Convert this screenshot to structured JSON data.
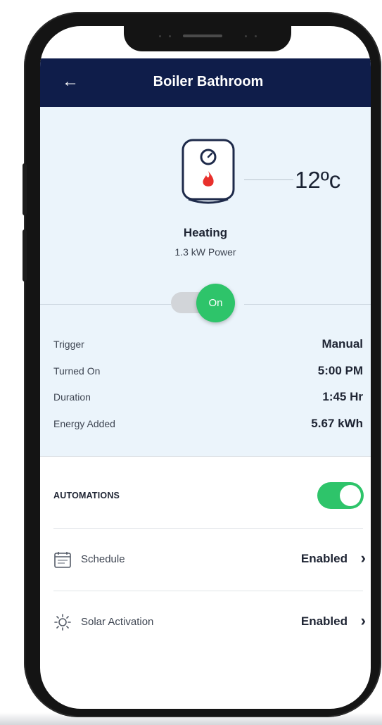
{
  "header": {
    "title": "Boiler Bathroom",
    "back_icon": "arrow-left-icon"
  },
  "device": {
    "temperature": "12ºc",
    "status_title": "Heating",
    "status_subtitle": "1.3 kW Power",
    "power_toggle": {
      "label": "On",
      "state": "on"
    },
    "icon": "water-heater-flame-icon"
  },
  "details": [
    {
      "label": "Trigger",
      "value": "Manual"
    },
    {
      "label": "Turned On",
      "value": "5:00 PM"
    },
    {
      "label": "Duration",
      "value": "1:45 Hr"
    },
    {
      "label": "Energy Added",
      "value": "5.67 kWh"
    }
  ],
  "automations": {
    "label": "AUTOMATIONS",
    "enabled": true,
    "items": [
      {
        "label": "Schedule",
        "value": "Enabled",
        "icon": "calendar-icon"
      },
      {
        "label": "Solar Activation",
        "value": "Enabled",
        "icon": "sun-icon"
      }
    ]
  },
  "colors": {
    "header_bg": "#0f1d4a",
    "info_bg": "#ebf4fb",
    "accent_green": "#2ec46a",
    "flame_red": "#e8302c"
  }
}
